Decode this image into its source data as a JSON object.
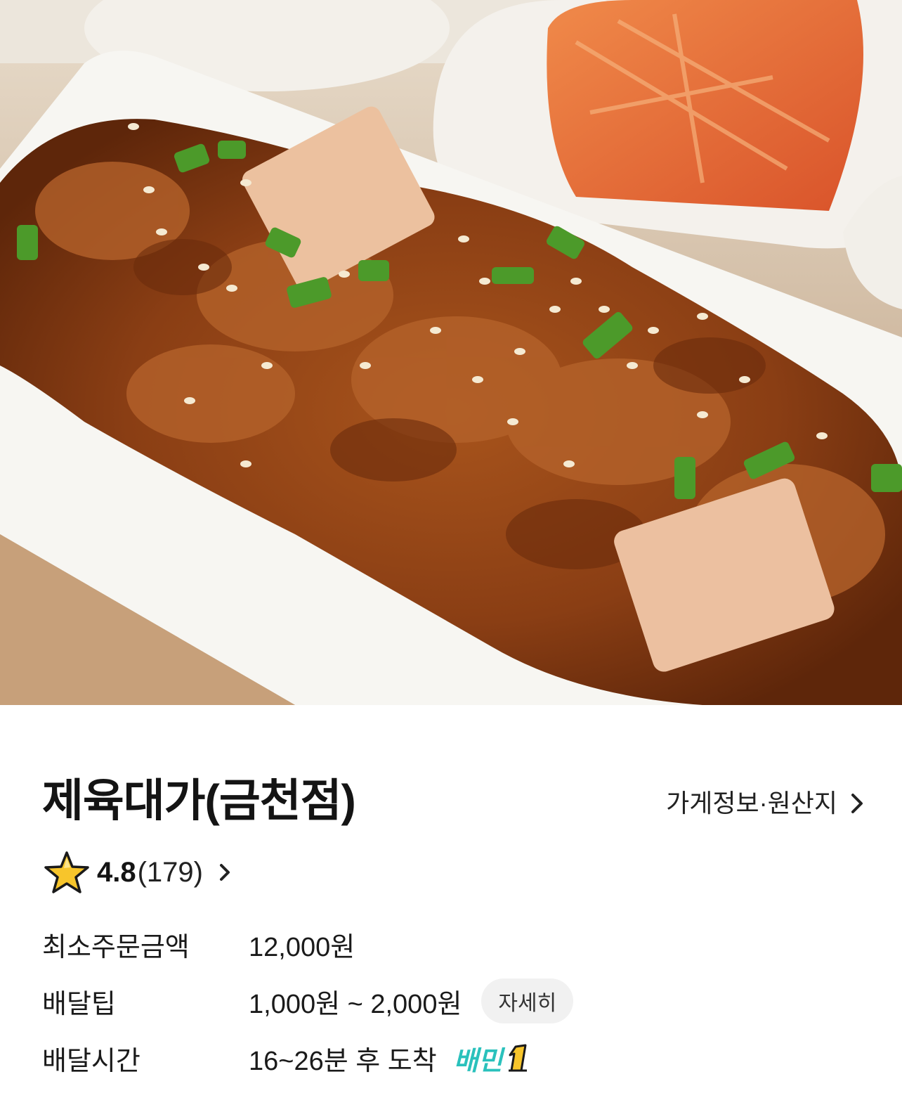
{
  "hero_image": {
    "alt": "제육볶음 사진"
  },
  "store": {
    "name": "제육대가(금천점)",
    "info_link_label": "가게정보·원산지"
  },
  "rating": {
    "score": "4.8",
    "count": "(179)"
  },
  "details": [
    {
      "label": "최소주문금액",
      "value": "12,000원"
    },
    {
      "label": "배달팁",
      "value": "1,000원 ~ 2,000원",
      "button": "자세히"
    },
    {
      "label": "배달시간",
      "value": "16~26분 후 도착",
      "badge": "배민"
    }
  ],
  "colors": {
    "brand_mint": "#2ac1bc",
    "star_yellow": "#f7c52b",
    "chip_bg": "#f1f1f1"
  },
  "icons": {
    "rating": "star-icon",
    "chevron": "chevron-right-icon",
    "badge": "baemin1-icon"
  }
}
